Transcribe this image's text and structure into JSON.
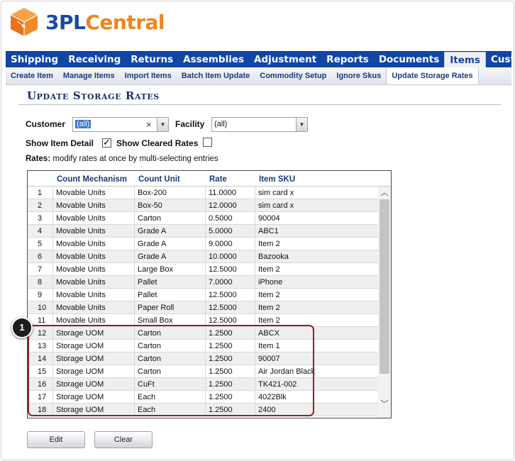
{
  "logo": {
    "part1": "3PL",
    "part2": "Central"
  },
  "main_nav": [
    {
      "label": "Shipping",
      "active": false
    },
    {
      "label": "Receiving",
      "active": false
    },
    {
      "label": "Returns",
      "active": false
    },
    {
      "label": "Assemblies",
      "active": false
    },
    {
      "label": "Adjustment",
      "active": false
    },
    {
      "label": "Reports",
      "active": false
    },
    {
      "label": "Documents",
      "active": false
    },
    {
      "label": "Items",
      "active": true
    },
    {
      "label": "Customer",
      "active": false
    }
  ],
  "sub_nav": [
    {
      "label": "Create Item",
      "active": false
    },
    {
      "label": "Manage Items",
      "active": false
    },
    {
      "label": "Import Items",
      "active": false
    },
    {
      "label": "Batch Item Update",
      "active": false
    },
    {
      "label": "Commodity Setup",
      "active": false
    },
    {
      "label": "Ignore Skus",
      "active": false
    },
    {
      "label": "Update Storage Rates",
      "active": true
    }
  ],
  "page_title": "Update Storage Rates",
  "filters": {
    "customer_label": "Customer",
    "customer_value": "(all)",
    "facility_label": "Facility",
    "facility_value": "(all)",
    "show_item_detail_label": "Show Item Detail",
    "show_item_detail_checked": true,
    "show_cleared_rates_label": "Show Cleared Rates",
    "show_cleared_rates_checked": false
  },
  "rates_note": {
    "label": "Rates:",
    "text": "modify rates at once by multi-selecting entries"
  },
  "grid": {
    "columns": [
      "",
      "Count Mechanism",
      "Count Unit",
      "Rate",
      "Item SKU"
    ],
    "rows": [
      [
        "1",
        "Movable Units",
        "Box-200",
        "11.0000",
        "sim card x"
      ],
      [
        "2",
        "Movable Units",
        "Box-50",
        "12.0000",
        "sim card x"
      ],
      [
        "3",
        "Movable Units",
        "Carton",
        "0.5000",
        "90004"
      ],
      [
        "4",
        "Movable Units",
        "Grade A",
        "5.0000",
        "ABC1"
      ],
      [
        "5",
        "Movable Units",
        "Grade A",
        "9.0000",
        "Item 2"
      ],
      [
        "6",
        "Movable Units",
        "Grade A",
        "10.0000",
        "Bazooka"
      ],
      [
        "7",
        "Movable Units",
        "Large Box",
        "12.5000",
        "Item 2"
      ],
      [
        "8",
        "Movable Units",
        "Pallet",
        "7.0000",
        "iPhone"
      ],
      [
        "9",
        "Movable Units",
        "Pallet",
        "12.5000",
        "Item 2"
      ],
      [
        "10",
        "Movable Units",
        "Paper Roll",
        "12.5000",
        "Item 2"
      ],
      [
        "11",
        "Movable Units",
        "Small Box",
        "12.5000",
        "Item 2"
      ],
      [
        "12",
        "Storage UOM",
        "Carton",
        "1.2500",
        "ABCX"
      ],
      [
        "13",
        "Storage UOM",
        "Carton",
        "1.2500",
        "Item 1"
      ],
      [
        "14",
        "Storage UOM",
        "Carton",
        "1.2500",
        "90007"
      ],
      [
        "15",
        "Storage UOM",
        "Carton",
        "1.2500",
        "Air Jordan Black"
      ],
      [
        "16",
        "Storage UOM",
        "CuFt",
        "1.2500",
        "TK421-002"
      ],
      [
        "17",
        "Storage UOM",
        "Each",
        "1.2500",
        "4022Blk"
      ],
      [
        "18",
        "Storage UOM",
        "Each",
        "1.2500",
        "2400"
      ]
    ]
  },
  "callout": {
    "number": "1",
    "color": "#8e2424"
  },
  "buttons": {
    "edit": "Edit",
    "clear": "Clear"
  },
  "colors": {
    "nav_blue": "#1145a6",
    "brand_orange": "#f0841c",
    "brand_blue": "#1a4aa0"
  }
}
